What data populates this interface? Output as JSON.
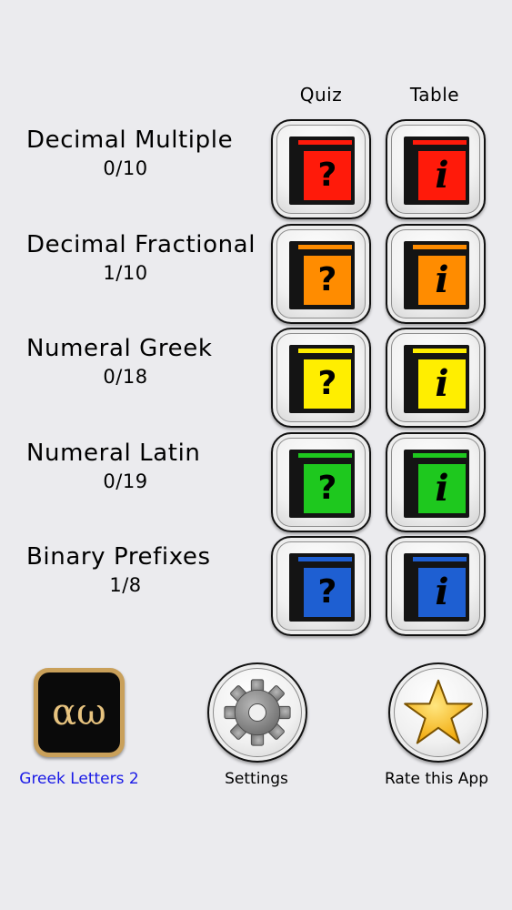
{
  "columns": {
    "quiz": "Quiz",
    "table": "Table"
  },
  "rows": [
    {
      "title": "Decimal Multiple",
      "score": "0/10",
      "color": "#ff1a0a",
      "stripe": "#ff1a0a"
    },
    {
      "title": "Decimal Fractional",
      "score": "1/10",
      "color": "#ff8c00",
      "stripe": "#ff8c00"
    },
    {
      "title": "Numeral Greek",
      "score": "0/18",
      "color": "#ffee00",
      "stripe": "#ffee00"
    },
    {
      "title": "Numeral Latin",
      "score": "0/19",
      "color": "#1ec81e",
      "stripe": "#1ec81e"
    },
    {
      "title": "Binary Prefixes",
      "score": "1/8",
      "color": "#1e5fd2",
      "stripe": "#1e5fd2"
    }
  ],
  "glyphs": {
    "quiz": "?",
    "table": "i"
  },
  "bottom": {
    "app": {
      "icon_text": "αω",
      "label": "Greek Letters 2",
      "label_color": "#1a1ae6"
    },
    "settings": {
      "label": "Settings",
      "icon": "gear-icon"
    },
    "rate": {
      "label": "Rate this App",
      "icon": "star-icon"
    }
  }
}
